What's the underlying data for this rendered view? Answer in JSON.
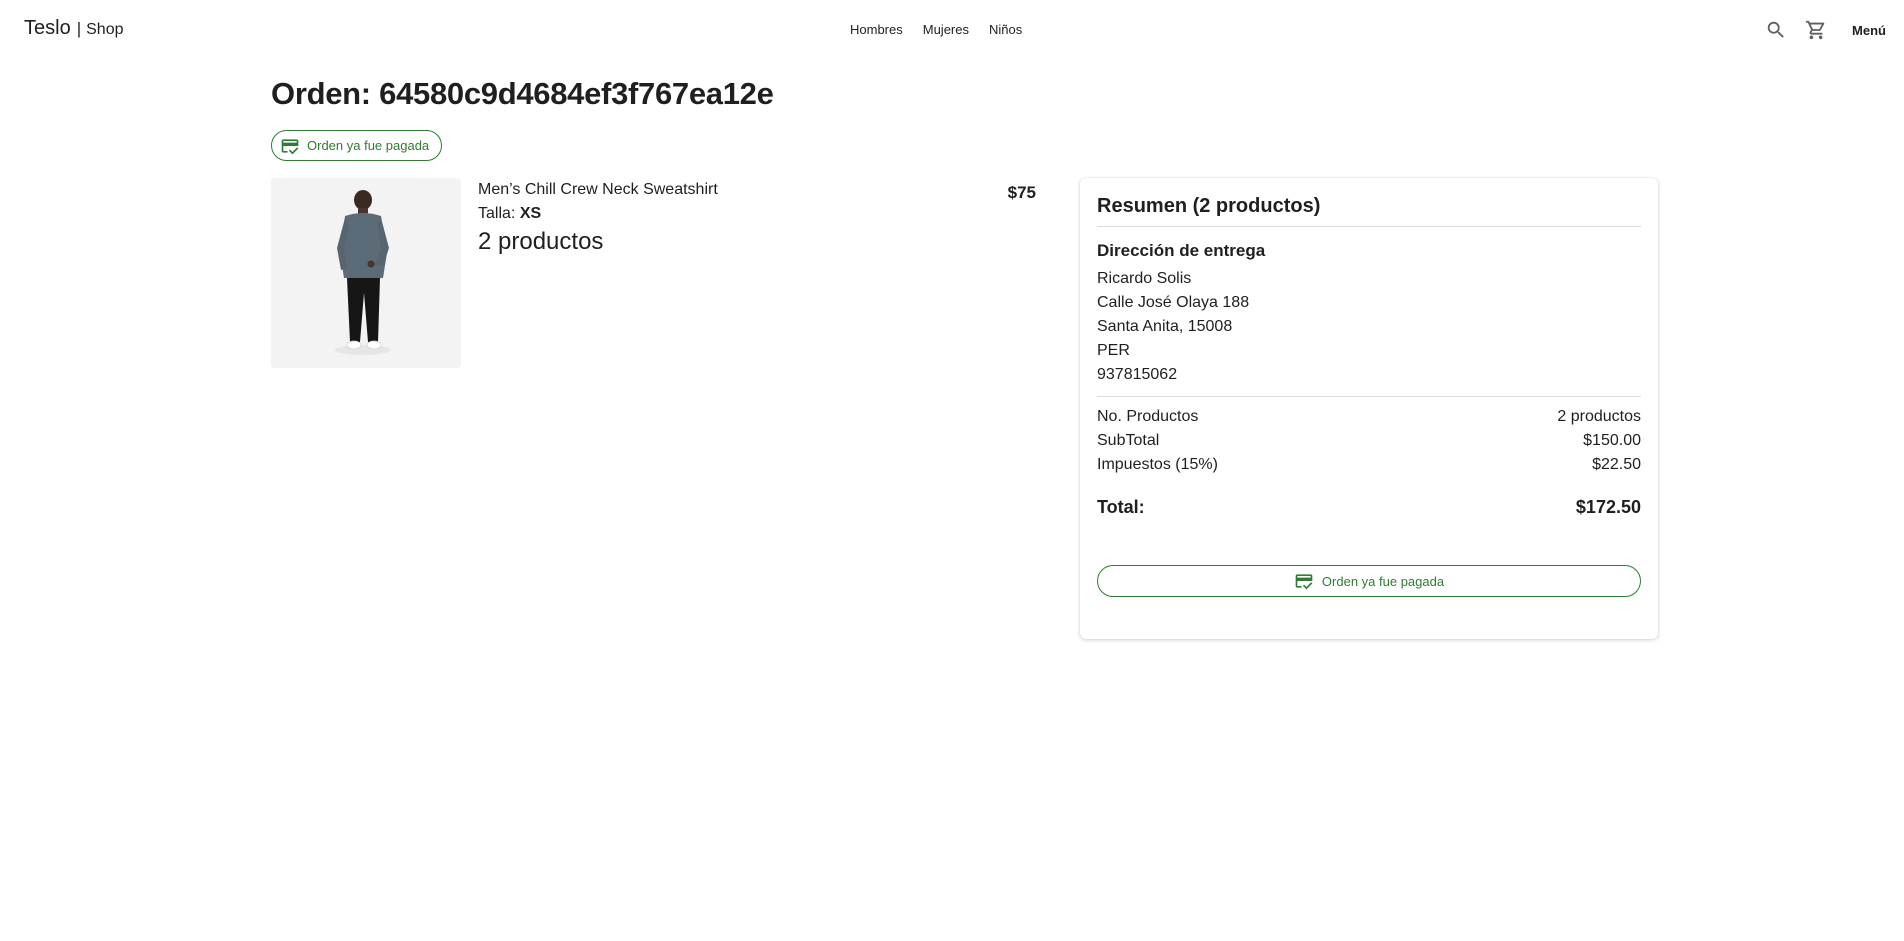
{
  "nav": {
    "brand_name": "Teslo",
    "brand_separator": "|",
    "brand_sub": "Shop",
    "links": [
      "Hombres",
      "Mujeres",
      "Niños"
    ],
    "menu_label": "Menú",
    "icons": [
      "search-icon",
      "cart-icon"
    ]
  },
  "order": {
    "title": "Orden: 64580c9d4684ef3f767ea12e",
    "status_chip": "Orden ya fue pagada"
  },
  "product": {
    "name": "Men’s Chill Crew Neck Sweatshirt",
    "size_label": "Talla:",
    "size_value": "XS",
    "quantity": "2 productos",
    "price": "$75"
  },
  "summary": {
    "title": "Resumen (2 productos)",
    "address_title": "Dirección de entrega",
    "address_lines": [
      "Ricardo Solis",
      "Calle José Olaya 188",
      "Santa Anita, 15008",
      "PER",
      "937815062"
    ],
    "rows": [
      {
        "label": "No. Productos",
        "value": "2 productos"
      },
      {
        "label": "SubTotal",
        "value": "$150.00"
      },
      {
        "label": "Impuestos (15%)",
        "value": "$22.50"
      }
    ],
    "total_label": "Total:",
    "total_value": "$172.50",
    "paid_button": "Orden ya fue pagada"
  },
  "colors": {
    "accent_green": "#2e7d32",
    "text": "#1f1f1f",
    "icon_gray": "#5f5f5f"
  }
}
